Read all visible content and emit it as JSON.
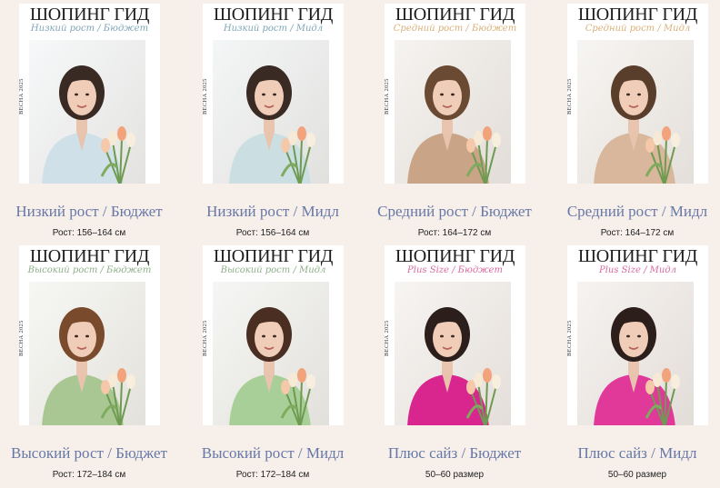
{
  "cards": [
    {
      "brand": "ШОПИНГ ГИД",
      "subtitle": "Низкий рост / Бюджет",
      "season": "ВЕСНА 2025",
      "title": "Низкий рост / Бюджет",
      "caption": "Рост: 156–164 см",
      "accent": "#7fa7b8",
      "outfit": "#cfe0e8",
      "bg": "#eef2f4",
      "hair": "#3a2a24"
    },
    {
      "brand": "ШОПИНГ ГИД",
      "subtitle": "Низкий рост / Мидл",
      "season": "ВЕСНА 2025",
      "title": "Низкий рост / Мидл",
      "caption": "Рост: 156–164 см",
      "accent": "#7fa7b8",
      "outfit": "#cbdee2",
      "bg": "#e9eeef",
      "hair": "#3a2a24"
    },
    {
      "brand": "ШОПИНГ ГИД",
      "subtitle": "Средний рост / Бюджет",
      "season": "ВЕСНА 2025",
      "title": "Средний рост / Бюджет",
      "caption": "Рост: 164–172 см",
      "accent": "#d9b07a",
      "outfit": "#c9a487",
      "bg": "#ece7e2",
      "hair": "#6b4a34"
    },
    {
      "brand": "ШОПИНГ ГИД",
      "subtitle": "Средний рост / Мидл",
      "season": "ВЕСНА 2025",
      "title": "Средний рост / Мидл",
      "caption": "Рост: 164–172 см",
      "accent": "#d9b07a",
      "outfit": "#d8b79c",
      "bg": "#efebe6",
      "hair": "#5a3e2c"
    },
    {
      "brand": "ШОПИНГ ГИД",
      "subtitle": "Высокий рост / Бюджет",
      "season": "ВЕСНА 2025",
      "title": "Высокий рост / Бюджет",
      "caption": "Рост: 172–184 см",
      "accent": "#8fb08a",
      "outfit": "#a9c792",
      "bg": "#eef0ea",
      "hair": "#7a4a2c"
    },
    {
      "brand": "ШОПИНГ ГИД",
      "subtitle": "Высокий рост / Мидл",
      "season": "ВЕСНА 2025",
      "title": "Высокий рост / Мидл",
      "caption": "Рост: 172–184 см",
      "accent": "#8fb08a",
      "outfit": "#a8cf98",
      "bg": "#eceeea",
      "hair": "#4a2e22"
    },
    {
      "brand": "ШОПИНГ ГИД",
      "subtitle": "Plus Size / Бюджет",
      "season": "ВЕСНА 2025",
      "title": "Плюс сайз / Бюджет",
      "caption": "50–60 размер",
      "accent": "#d86aa0",
      "outfit": "#d9268f",
      "bg": "#efeae6",
      "hair": "#2c1e1a"
    },
    {
      "brand": "ШОПИНГ ГИД",
      "subtitle": "Plus Size / Мидл",
      "season": "ВЕСНА 2025",
      "title": "Плюс сайз / Мидл",
      "caption": "50–60 размер",
      "accent": "#d86aa0",
      "outfit": "#e0399a",
      "bg": "#ede7e3",
      "hair": "#2c1e1a"
    }
  ]
}
